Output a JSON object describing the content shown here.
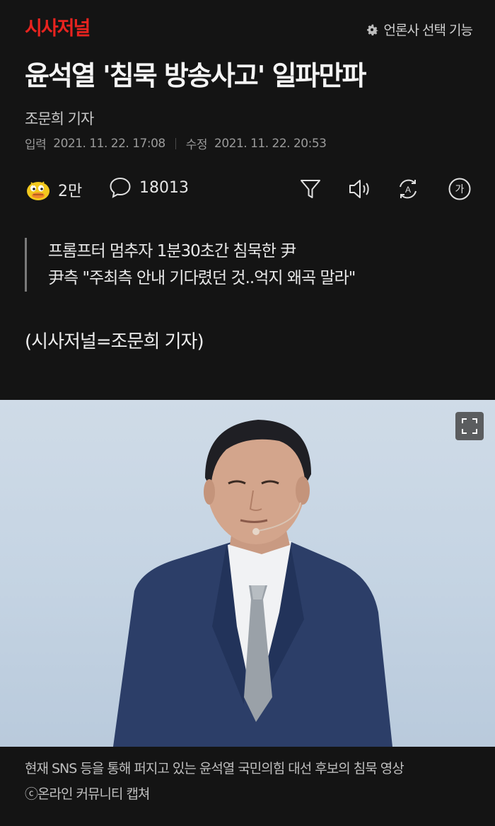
{
  "header": {
    "brand": "시사저널",
    "press_select_label": "언론사 선택 기능",
    "icon": "gear-icon"
  },
  "article": {
    "title": "윤석열 '침묵 방송사고' 일파만파",
    "byline": "조문희 기자",
    "input_label": "입력",
    "input_date": "2021. 11. 22. 17:08",
    "modified_label": "수정",
    "modified_date": "2021. 11. 22. 20:53",
    "summary": [
      "프롬프터 멈추자 1분30초간 침묵한 尹",
      "尹측 \"주최측 안내 기다렸던 것..억지 왜곡 말라\""
    ],
    "credit": "(시사저널=조문희 기자)"
  },
  "actions": {
    "reaction_count": "2만",
    "comment_count": "18013",
    "icons": [
      "reaction-duck-icon",
      "comment-icon",
      "filter-icon",
      "speaker-icon",
      "translate-icon",
      "font-size-icon"
    ],
    "font_size_glyph": "가",
    "translate_glyph": "A"
  },
  "photo": {
    "caption_line1": "현재 SNS 등을 통해 퍼지고 있는 윤석열 국민의힘 대선 후보의 침묵 영상",
    "caption_line2": "ⓒ온라인 커뮤니티 캡쳐"
  },
  "colors": {
    "background": "#141414",
    "brand": "#e8231f",
    "text": "#f2f2f2",
    "muted": "#9a9a9a",
    "suit": "#2c3e68"
  }
}
